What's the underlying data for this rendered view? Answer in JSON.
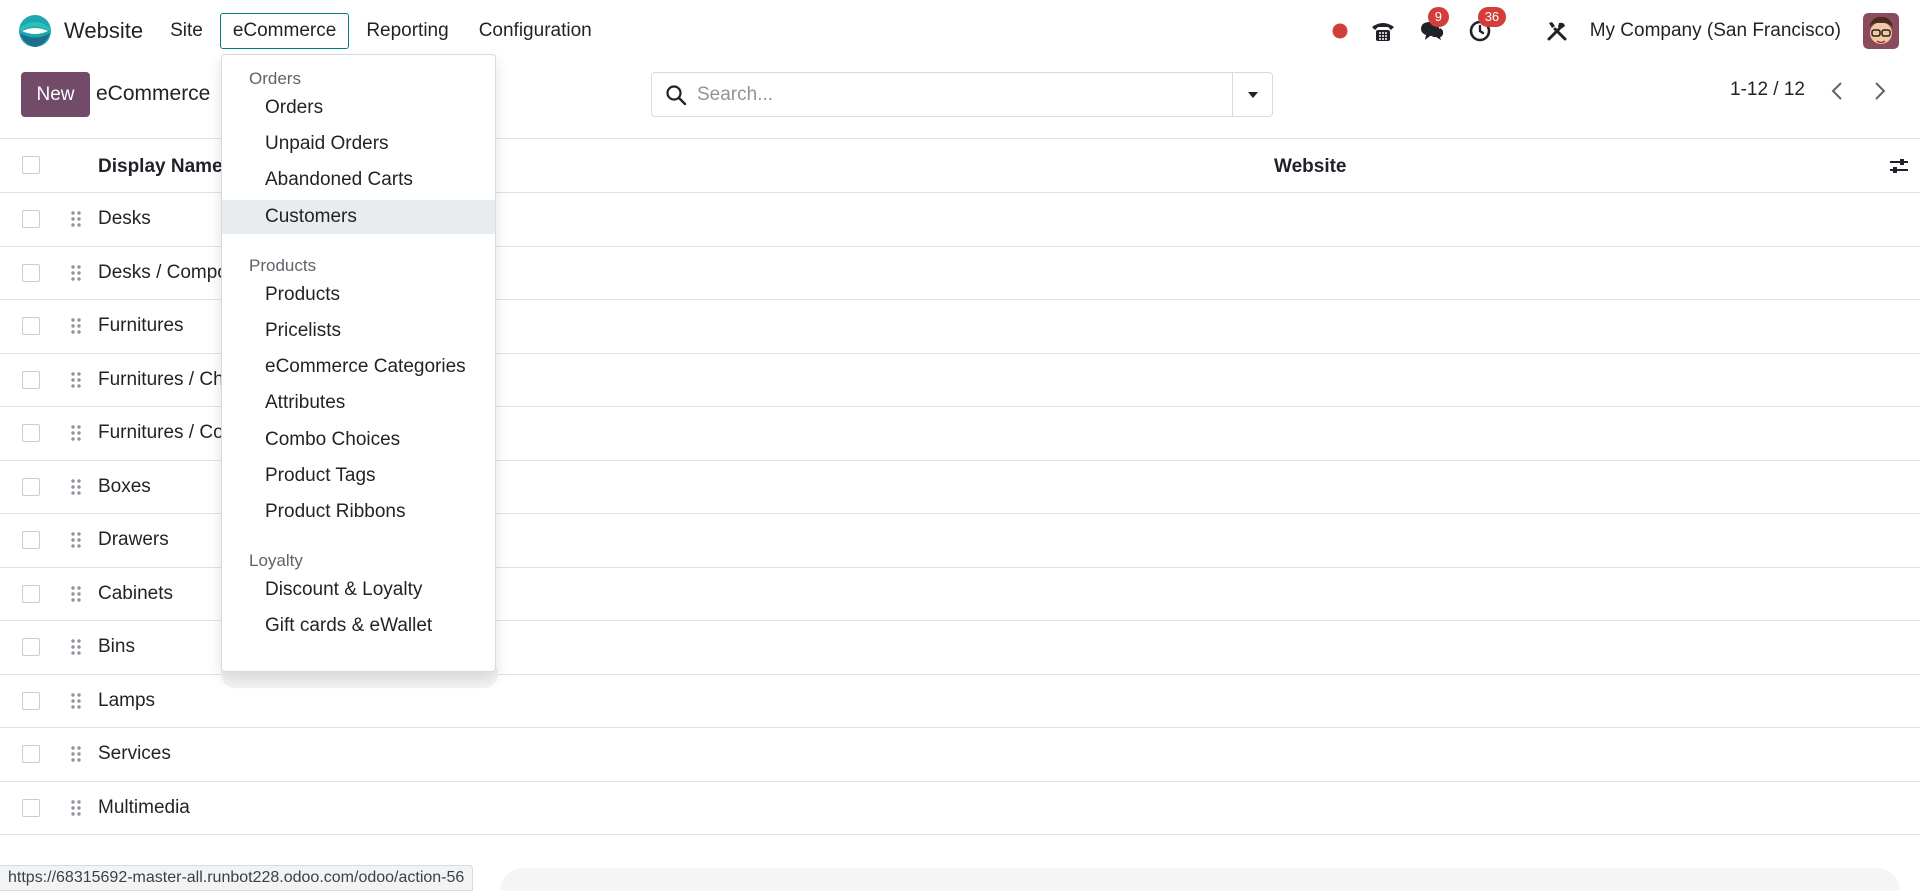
{
  "navbar": {
    "app_name": "Website",
    "menu": [
      {
        "label": "Site",
        "active": false
      },
      {
        "label": "eCommerce",
        "active": true
      },
      {
        "label": "Reporting",
        "active": false
      },
      {
        "label": "Configuration",
        "active": false
      }
    ],
    "systray": {
      "messages_badge": "9",
      "activities_badge": "36",
      "company": "My Company (San Francisco)"
    }
  },
  "control_panel": {
    "new_button": "New",
    "title": "eCommerce",
    "search_placeholder": "Search...",
    "pager": "1-12 / 12"
  },
  "table": {
    "columns": [
      "Display Name",
      "Website"
    ],
    "rows": [
      "Desks",
      "Desks / Compo",
      "Furnitures",
      "Furnitures / Ch",
      "Furnitures / Co",
      "Boxes",
      "Drawers",
      "Cabinets",
      "Bins",
      "Lamps",
      "Services",
      "Multimedia"
    ]
  },
  "dropdown": {
    "sections": [
      {
        "header": "Orders",
        "items": [
          "Orders",
          "Unpaid Orders",
          "Abandoned Carts",
          "Customers"
        ]
      },
      {
        "header": "Products",
        "items": [
          "Products",
          "Pricelists",
          "eCommerce Categories",
          "Attributes",
          "Combo Choices",
          "Product Tags",
          "Product Ribbons"
        ]
      },
      {
        "header": "Loyalty",
        "items": [
          "Discount & Loyalty",
          "Gift cards & eWallet"
        ]
      }
    ],
    "hovered_item": "Customers"
  },
  "statusbar": {
    "url": "https://68315692-master-all.runbot228.odoo.com/odoo/action-56"
  },
  "colors": {
    "primary": "#714b67",
    "accent": "#017e84",
    "badge": "#d23f3a",
    "record_dot": "#d23f3a"
  }
}
